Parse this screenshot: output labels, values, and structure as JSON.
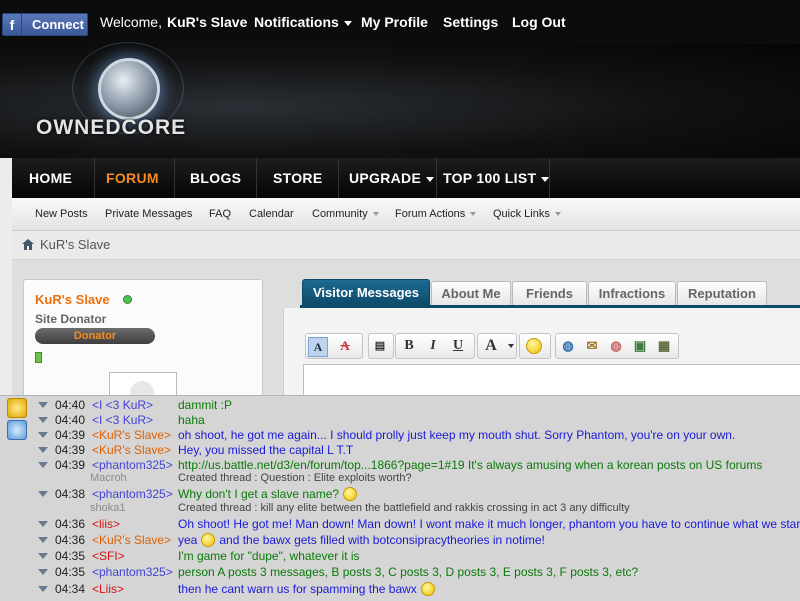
{
  "topbar": {
    "facebook_button": "Connect",
    "welcome_text": "Welcome,",
    "username": "KuR's Slave",
    "notifications": "Notifications",
    "my_profile": "My Profile",
    "settings": "Settings",
    "log_out": "Log Out"
  },
  "logo": {
    "text": "OWNEDCORE"
  },
  "main_nav": [
    "HOME",
    "FORUM",
    "BLOGS",
    "STORE",
    "UPGRADE",
    "TOP 100 LIST"
  ],
  "sub_nav": [
    "New Posts",
    "Private Messages",
    "FAQ",
    "Calendar",
    "Community",
    "Forum Actions",
    "Quick Links"
  ],
  "breadcrumb": "KuR's Slave",
  "profile": {
    "username": "KuR's Slave",
    "title": "Site Donator",
    "badge": "Donator"
  },
  "tabs": [
    "Visitor Messages",
    "About Me",
    "Friends",
    "Infractions",
    "Reputation"
  ],
  "toolbar": {
    "bold": "B",
    "italic": "I",
    "underline": "U",
    "font": "A",
    "text_icon": "A"
  },
  "chat": {
    "rows": [
      {
        "time": "04:40",
        "nick": "<I <3 KuR>",
        "text": "dammit :P",
        "sub": "",
        "meta": ""
      },
      {
        "time": "04:40",
        "nick": "<I <3 KuR>",
        "text": "haha",
        "sub": "",
        "meta": ""
      },
      {
        "time": "04:39",
        "nick": "<KuR's Slave>",
        "text": "oh shoot, he got me again... I should prolly just keep my mouth shut. Sorry Phantom, you're on your own.",
        "sub": "",
        "meta": ""
      },
      {
        "time": "04:39",
        "nick": "<KuR's Slave>",
        "text": "Hey, you missed the capital L T.T",
        "sub": "",
        "meta": ""
      },
      {
        "time": "04:39",
        "nick": "<phantom325>",
        "text": "http://us.battle.net/d3/en/forum/top...1866?page=1#19 It's always amusing when a korean posts on US forums",
        "sub": "Macroh",
        "meta": "Created thread : Question : Elite exploits worth?"
      },
      {
        "time": "04:38",
        "nick": "<phantom325>",
        "text": "Why don't I get a slave name?",
        "sub": "shoka1",
        "meta": "Created thread : kill any elite between the battlefield and rakkis crossing in act 3 any difficulty"
      },
      {
        "time": "04:36",
        "nick": "<liis>",
        "text": "Oh shoot! He got me! Man down! Man down! I wont make it much longer, phantom you have to continue what we started",
        "sub": "",
        "meta": ""
      },
      {
        "time": "04:36",
        "nick": "<KuR's Slave>",
        "text": "yea",
        "text2": "and the bawx gets filled with botconsipracytheories in notime!",
        "sub": "",
        "meta": ""
      },
      {
        "time": "04:35",
        "nick": "<SFI>",
        "text": "I'm game for \"dupe\", whatever it is",
        "sub": "",
        "meta": ""
      },
      {
        "time": "04:35",
        "nick": "<phantom325>",
        "text": "person A posts 3 messages, B posts 3, C posts 3, D posts 3, E posts 3, F posts 3, etc?",
        "sub": "",
        "meta": ""
      },
      {
        "time": "04:34",
        "nick": "<Liis>",
        "text": "then he cant warn us for spamming the bawx",
        "sub": "",
        "meta": ""
      }
    ]
  },
  "colors": {
    "accent": "#f68b1f",
    "tab_active": "#0e4a69",
    "facebook": "#3b5998"
  }
}
